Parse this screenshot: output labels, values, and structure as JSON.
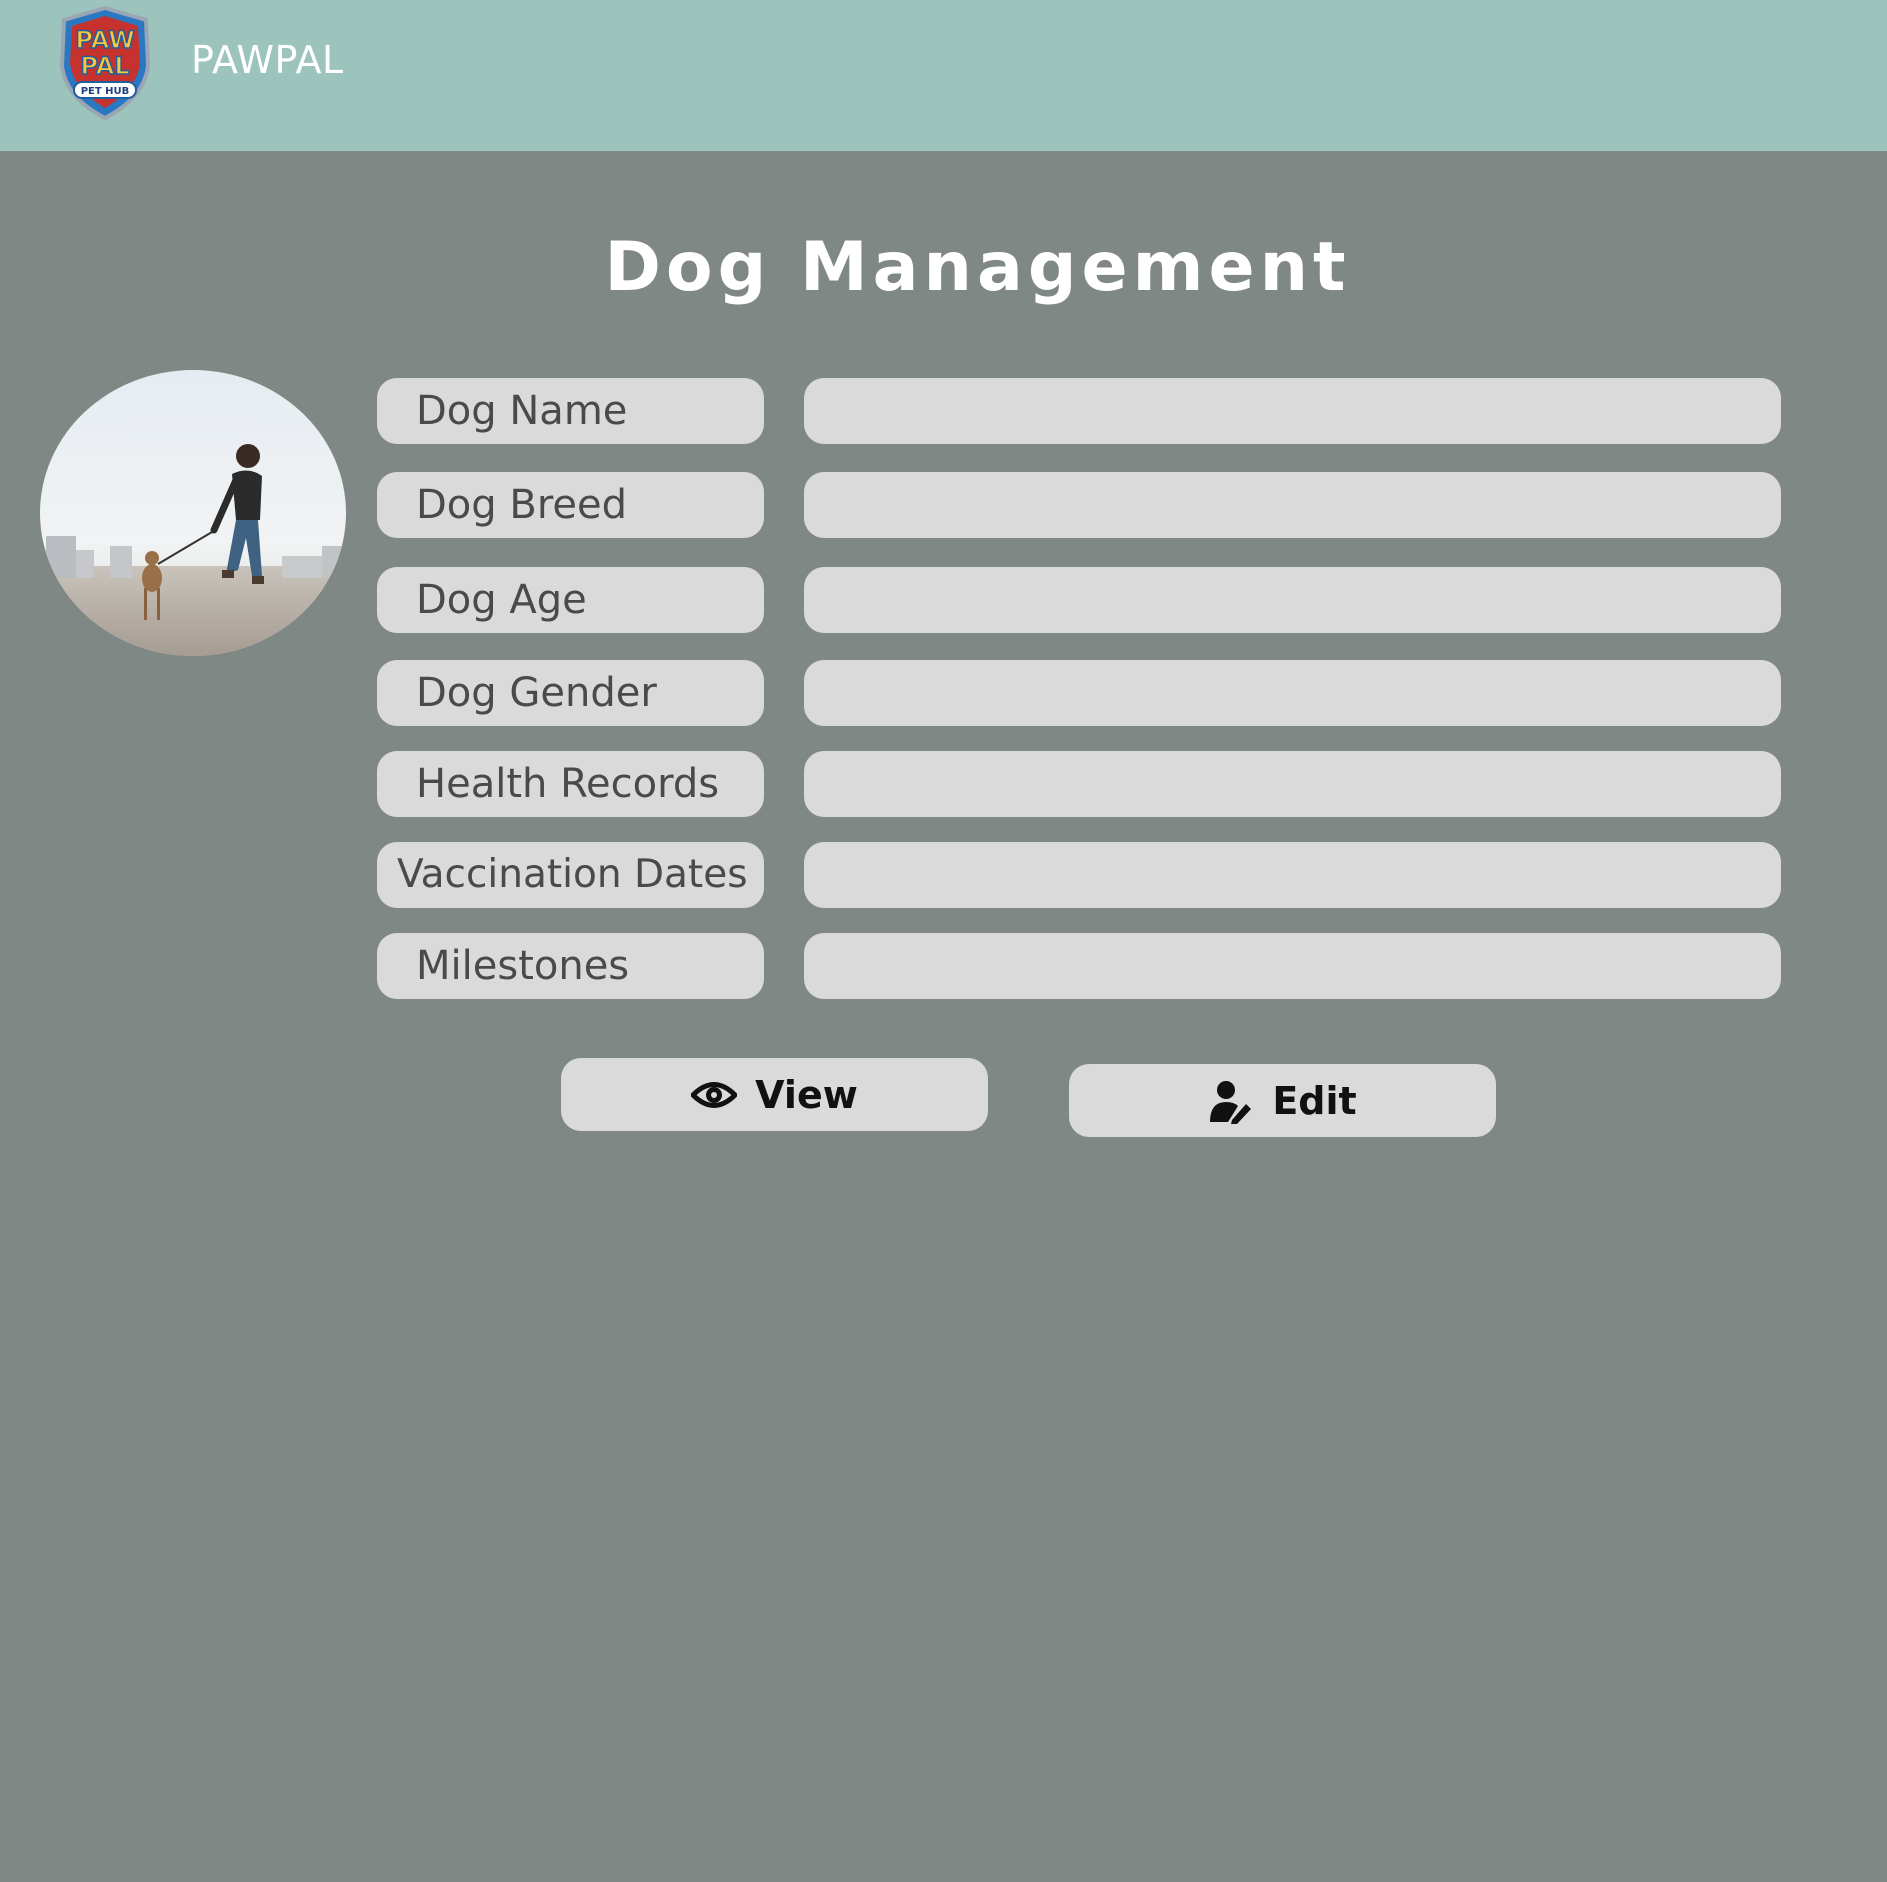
{
  "header": {
    "brand": "PAWPAL",
    "logo_text": [
      "PAW",
      "PAL",
      "PET HUB"
    ],
    "logo_icon": "pawpal-shield-logo"
  },
  "page": {
    "title": "Dog Management"
  },
  "photo": {
    "description_icon": "woman-walking-dog-photo"
  },
  "form": {
    "fields": [
      {
        "label": "Dog Name",
        "value": ""
      },
      {
        "label": "Dog Breed",
        "value": ""
      },
      {
        "label": "Dog Age",
        "value": ""
      },
      {
        "label": "Dog Gender",
        "value": ""
      },
      {
        "label": "Health Records",
        "value": ""
      },
      {
        "label": "Vaccination Dates",
        "value": ""
      },
      {
        "label": "Milestones",
        "value": ""
      }
    ]
  },
  "actions": {
    "view_label": "View",
    "view_icon": "eye-icon",
    "edit_label": "Edit",
    "edit_icon": "user-edit-icon"
  },
  "colors": {
    "header_bg": "#9cc4bc",
    "page_bg": "#7f8884",
    "field_bg": "#dadada"
  }
}
